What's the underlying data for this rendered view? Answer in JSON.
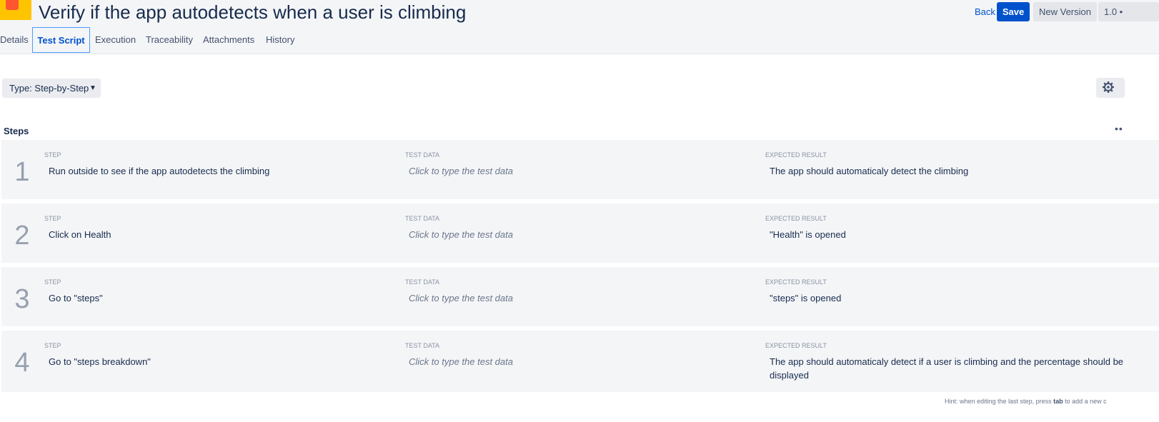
{
  "page": {
    "title": "Verify if the app autodetects when a user is climbing"
  },
  "header_actions": {
    "back_label": "Back",
    "save_label": "Save",
    "new_version_label": "New Version",
    "version_label": "1.0 •"
  },
  "tabs": [
    {
      "label": "Details"
    },
    {
      "label": "Test Script",
      "active": true
    },
    {
      "label": "Execution"
    },
    {
      "label": "Traceability"
    },
    {
      "label": "Attachments"
    },
    {
      "label": "History"
    }
  ],
  "script": {
    "type_label": "Type: Step-by-Step",
    "steps_heading": "Steps",
    "more_label": "••",
    "columns": {
      "step": "STEP",
      "test_data": "TEST DATA",
      "expected": "EXPECTED RESULT"
    },
    "steps": [
      {
        "number": "1",
        "step": "Run outside to see if the app autodetects the climbing",
        "test_data": "Click to type the test data",
        "expected": "The app should automaticaly detect the climbing"
      },
      {
        "number": "2",
        "step": "Click on Health",
        "test_data": "Click to type the test data",
        "expected": "\"Health\" is opened"
      },
      {
        "number": "3",
        "step": "Go to \"steps\"",
        "test_data": "Click to type the test data",
        "expected": "\"steps\" is opened"
      },
      {
        "number": "4",
        "step": "Go to \"steps breakdown\"",
        "test_data": "Click to type the test data",
        "expected": "The app should automaticaly detect if a user is climbing and the percentage should be displayed"
      }
    ],
    "hint_prefix": "Hint: when editing the last step, press",
    "hint_key": "tab",
    "hint_suffix": "to add a new c"
  },
  "icons": {
    "gear": "gear-icon",
    "chevron": "chevron-down-icon"
  },
  "colors": {
    "accent": "#0052cc",
    "row_bg": "#f4f5f7",
    "logo_yellow": "#ffc400",
    "logo_red": "#ff5630"
  }
}
